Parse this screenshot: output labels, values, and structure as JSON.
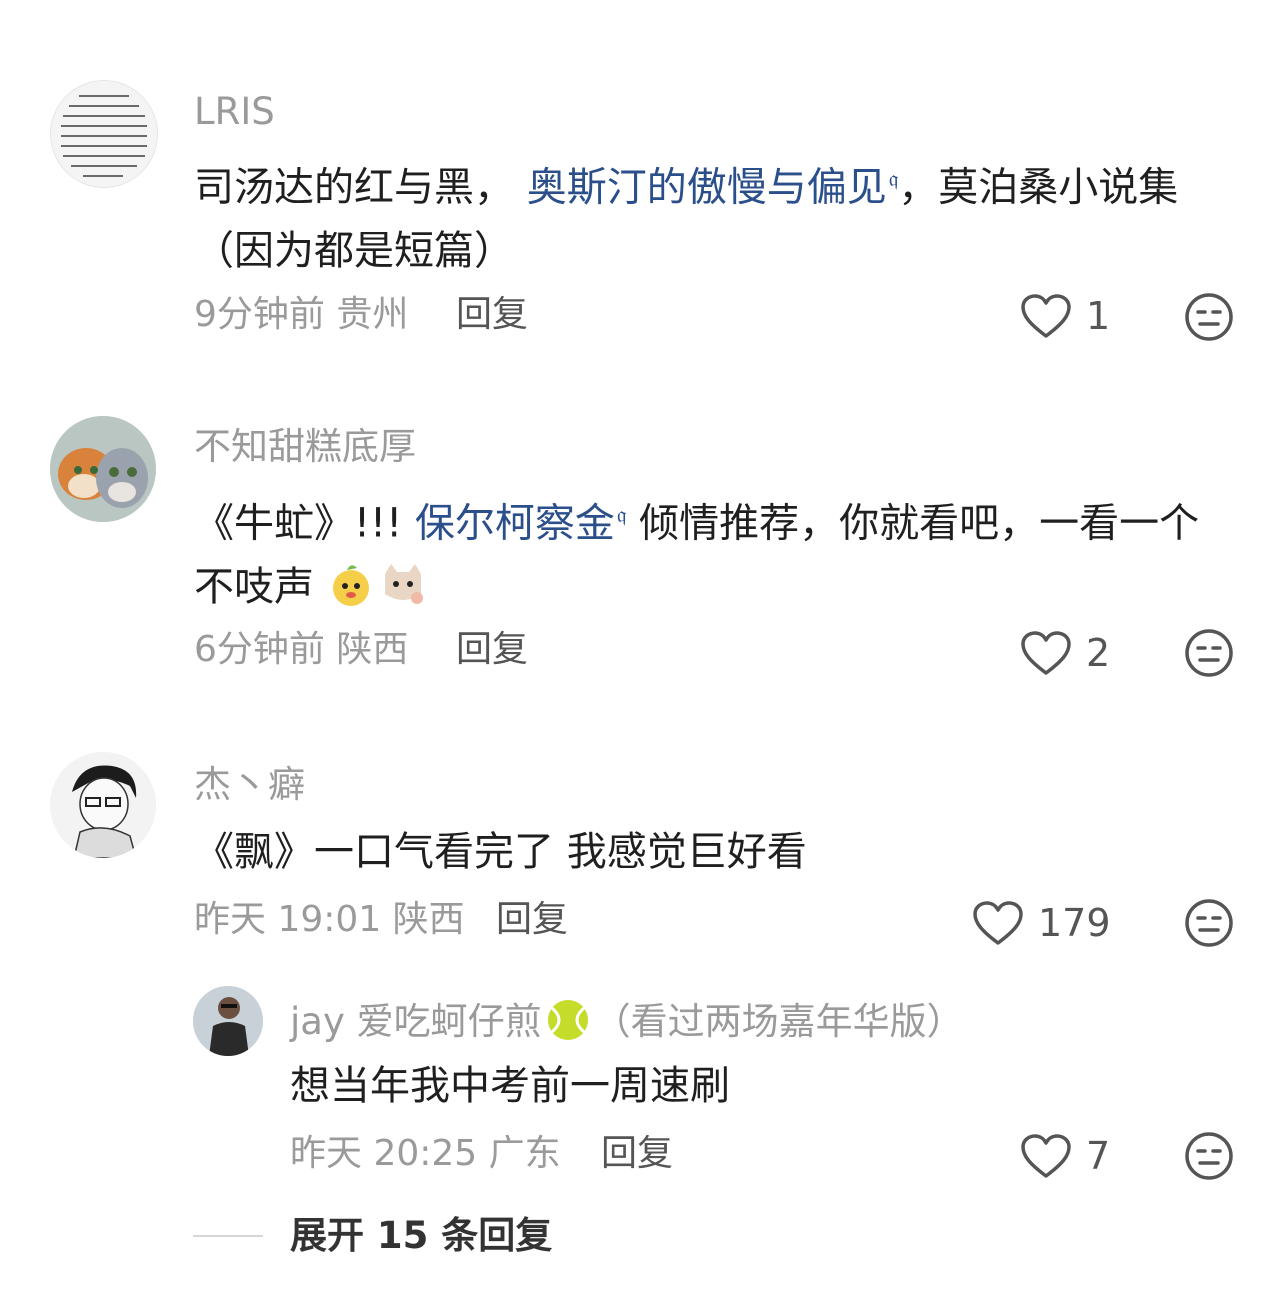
{
  "comments": [
    {
      "username": "LRIS",
      "text_prefix": "司汤达的红与黑， ",
      "text_link": "奥斯汀的傲慢与偏见",
      "text_suffix": "，莫泊桑小说集（因为都是短篇）",
      "time": "9分钟前",
      "location": "贵州",
      "reply_label": "回复",
      "likes": "1"
    },
    {
      "username": "不知甜糕底厚",
      "text_prefix": "《牛虻》!!!  ",
      "text_link": "保尔柯察金",
      "text_suffix": " 倾情推荐，你就看吧，一看一个不吱声",
      "time": "6分钟前",
      "location": "陕西",
      "reply_label": "回复",
      "likes": "2"
    },
    {
      "username": "杰丶癖",
      "text": "《飘》一口气看完了 我感觉巨好看",
      "time": "昨天 19:01",
      "location": "陕西",
      "reply_label": "回复",
      "likes": "179"
    }
  ],
  "sub_reply": {
    "username": "jay 爱吃蚵仔煎",
    "username_suffix": "（看过两场嘉年华版）",
    "text": "想当年我中考前一周速刷",
    "time": "昨天 20:25",
    "location": "广东",
    "reply_label": "回复",
    "likes": "7"
  },
  "expand_label": "展开 15 条回复",
  "icons": {
    "like": "heart-outline-icon",
    "face": "neutral-face-icon",
    "search_mark": "search-icon",
    "tennis": "tennis-ball-icon"
  },
  "colors": {
    "link": "#2b4f8a",
    "meta": "#9a9a9a",
    "text": "#1f1f1f"
  }
}
